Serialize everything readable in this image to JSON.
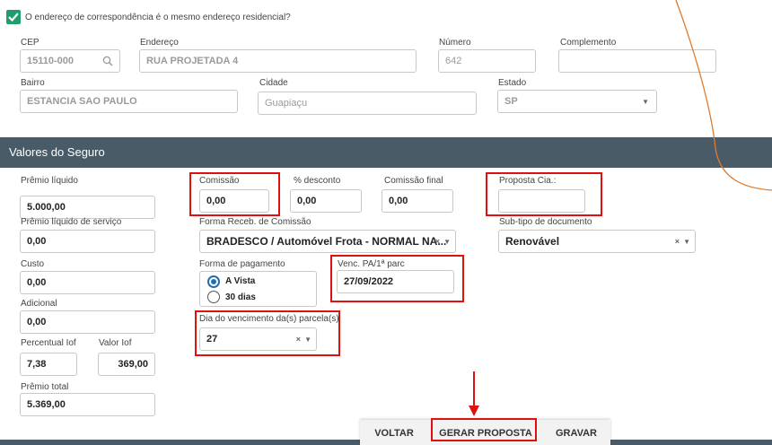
{
  "address": {
    "same_address_label": "O endereço de correspondência é o mesmo endereço residencial?",
    "same_address_checked": true,
    "cep_label": "CEP",
    "cep_value": "15110-000",
    "endereco_label": "Endereço",
    "endereco_value": "RUA PROJETADA 4",
    "numero_label": "Número",
    "numero_value": "642",
    "complemento_label": "Complemento",
    "complemento_value": "",
    "bairro_label": "Bairro",
    "bairro_value": "ESTANCIA SAO PAULO",
    "cidade_label": "Cidade",
    "cidade_value": "Guapiaçu",
    "estado_label": "Estado",
    "estado_value": "SP"
  },
  "section": {
    "title": "Valores do Seguro"
  },
  "valores": {
    "premio_liquido_label": "Prêmio líquido",
    "premio_liquido_value": "5.000,00",
    "premio_servico_label": "Prêmio líquido de serviço",
    "premio_servico_value": "0,00",
    "custo_label": "Custo",
    "custo_value": "0,00",
    "adicional_label": "Adicional",
    "adicional_value": "0,00",
    "percentual_iof_label": "Percentual Iof",
    "percentual_iof_value": "7,38",
    "valor_iof_label": "Valor Iof",
    "valor_iof_value": "369,00",
    "premio_total_label": "Prêmio total",
    "premio_total_value": "5.369,00",
    "comissao_label": "Comissão",
    "comissao_value": "0,00",
    "desconto_label": "% desconto",
    "desconto_value": "0,00",
    "comissao_final_label": "Comissão final",
    "comissao_final_value": "0,00",
    "proposta_label": "Proposta Cia.:",
    "proposta_value": "",
    "forma_receb_label": "Forma Receb. de Comissão",
    "forma_receb_value": "BRADESCO / Automóvel Frota - NORMAL NA...",
    "subtipo_label": "Sub-tipo de documento",
    "subtipo_value": "Renovável",
    "forma_pagamento_label": "Forma de pagamento",
    "pagamento_options": [
      "A Vista",
      "30 dias"
    ],
    "pagamento_selected": "A Vista",
    "venc_label": "Venc. PA/1ª parc",
    "venc_value": "27/09/2022",
    "dia_venc_label": "Dia do vencimento da(s) parcela(s)",
    "dia_venc_value": "27"
  },
  "actions": {
    "voltar": "VOLTAR",
    "gerar_proposta": "GERAR PROPOSTA",
    "gravar": "GRAVAR"
  },
  "icons": {
    "check": "check-icon",
    "search": "search-icon",
    "select": "chevron-down-icon",
    "clear": "clear-icon"
  },
  "colors": {
    "section_bar": "#4a5b68",
    "checkbox": "#1e9e6a",
    "highlight": "#e01010",
    "radio": "#1f6fb2"
  }
}
